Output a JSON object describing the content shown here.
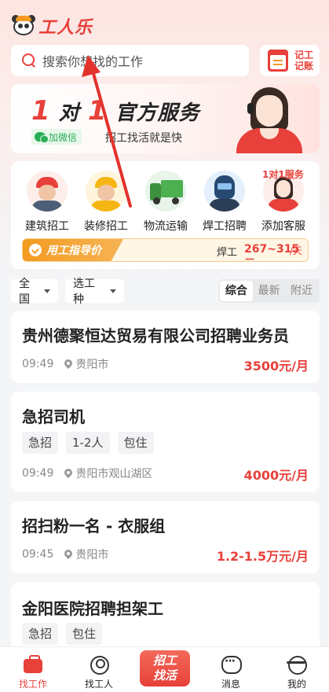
{
  "header": {
    "logo_text": "工人乐",
    "search_placeholder": "搜索你想找的工作",
    "record_label": "记工记账"
  },
  "banner": {
    "title_num1": "1",
    "title_mid": "对",
    "title_num2": "1",
    "title_rest": "官方服务",
    "wechat_label": "加微信",
    "subtitle": "招工找活就是快"
  },
  "categories": {
    "items": [
      {
        "label": "建筑招工",
        "icon": "construction-worker-icon"
      },
      {
        "label": "装修招工",
        "icon": "decoration-worker-icon"
      },
      {
        "label": "物流运输",
        "icon": "truck-icon"
      },
      {
        "label": "焊工招聘",
        "icon": "welder-icon"
      },
      {
        "label": "添加客服",
        "icon": "customer-service-icon"
      }
    ],
    "service_badge": "1对1服务",
    "wage_guide": {
      "label": "用工指导价",
      "job": "焊工",
      "range": "267~315元",
      "unit": "/天"
    }
  },
  "filters": {
    "region": "全国",
    "job_type": "选工种",
    "sort": [
      "综合",
      "最新",
      "附近"
    ],
    "sort_active": "综合"
  },
  "jobs": [
    {
      "title": "贵州德聚恒达贸易有限公司招聘业务员",
      "tags": [],
      "time": "09:49",
      "location": "贵阳市",
      "salary": "3500元/月"
    },
    {
      "title": "急招司机",
      "tags": [
        "急招",
        "1-2人",
        "包住"
      ],
      "time": "09:49",
      "location": "贵阳市观山湖区",
      "salary": "4000元/月"
    },
    {
      "title": "招扫粉一名 - 衣服组",
      "tags": [],
      "time": "09:45",
      "location": "贵阳市",
      "salary": "1.2-1.5万元/月"
    },
    {
      "title": "金阳医院招聘担架工",
      "tags": [
        "急招",
        "包住"
      ],
      "time": "",
      "location": "",
      "salary": ""
    }
  ],
  "tabbar": {
    "items": [
      "找工作",
      "找工人",
      "消息",
      "我的"
    ],
    "post_label_line1": "招工",
    "post_label_line2": "找活",
    "active": "找工作"
  },
  "colors": {
    "accent": "#e8403a",
    "orange": "#f39b21",
    "background": "#f4f5f7"
  }
}
